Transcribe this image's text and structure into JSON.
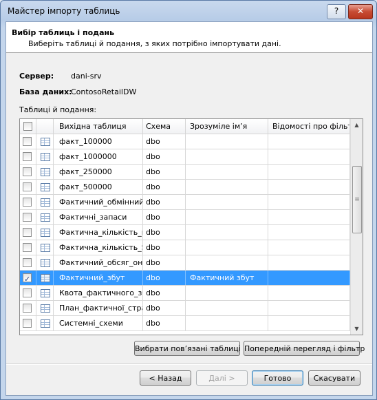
{
  "window": {
    "title": "Майстер імпорту таблиць",
    "help_label": "?",
    "close_label": "✕"
  },
  "header": {
    "title": "Вибір таблиць і подань",
    "subtitle": "Виберіть таблиці й подання, з яких потрібно імпортувати дані."
  },
  "server": {
    "label": "Сервер:",
    "value": "dani-srv"
  },
  "database": {
    "label": "База даних:",
    "value": "ContosoRetailDW"
  },
  "tables_label": "Таблиці й подання:",
  "grid": {
    "columns": [
      "Вихідна таблиця",
      "Схема",
      "Зрозуміле ім’я",
      "Відомості про фільтр"
    ],
    "rows": [
      {
        "name": "факт_100000",
        "schema": "dbo",
        "friendly": "",
        "filter": "",
        "checked": false
      },
      {
        "name": "факт_1000000",
        "schema": "dbo",
        "friendly": "",
        "filter": "",
        "checked": false
      },
      {
        "name": "факт_250000",
        "schema": "dbo",
        "friendly": "",
        "filter": "",
        "checked": false
      },
      {
        "name": "факт_500000",
        "schema": "dbo",
        "friendly": "",
        "filter": "",
        "checked": false
      },
      {
        "name": "Фактичний_обмінний_курс",
        "schema": "dbo",
        "friendly": "",
        "filter": "",
        "checked": false
      },
      {
        "name": "Фактичні_запаси",
        "schema": "dbo",
        "friendly": "",
        "filter": "",
        "checked": false
      },
      {
        "name": "Фактична_кількість_комплектів",
        "schema": "dbo",
        "friendly": "",
        "filter": "",
        "checked": false
      },
      {
        "name": "Фактична_кількість_SLA",
        "schema": "dbo",
        "friendly": "",
        "filter": "",
        "checked": false
      },
      {
        "name": "Фактичний_обсяг_онлайн",
        "schema": "dbo",
        "friendly": "",
        "filter": "",
        "checked": false
      },
      {
        "name": "Фактичний_збут",
        "schema": "dbo",
        "friendly": "Фактичний збут",
        "filter": "",
        "checked": true
      },
      {
        "name": "Квота_фактичного_збуту",
        "schema": "dbo",
        "friendly": "",
        "filter": "",
        "checked": false
      },
      {
        "name": "План_фактичної_стратегії",
        "schema": "dbo",
        "friendly": "",
        "filter": "",
        "checked": false
      },
      {
        "name": "Системні_схеми",
        "schema": "dbo",
        "friendly": "",
        "filter": "",
        "checked": false
      }
    ],
    "selected_index": 9
  },
  "buttons": {
    "select_related": "Вибрати пов’язані таблиці",
    "preview_filter": "Попередній перегляд і фільтр",
    "back": "< Назад",
    "next": "Далі >",
    "finish": "Готово",
    "cancel": "Скасувати"
  },
  "icons": {
    "checkbox": "checkbox-icon",
    "table": "table-icon",
    "scroll_up": "chevron-up-icon",
    "scroll_down": "chevron-down-icon",
    "help": "help-icon",
    "close": "close-icon"
  }
}
